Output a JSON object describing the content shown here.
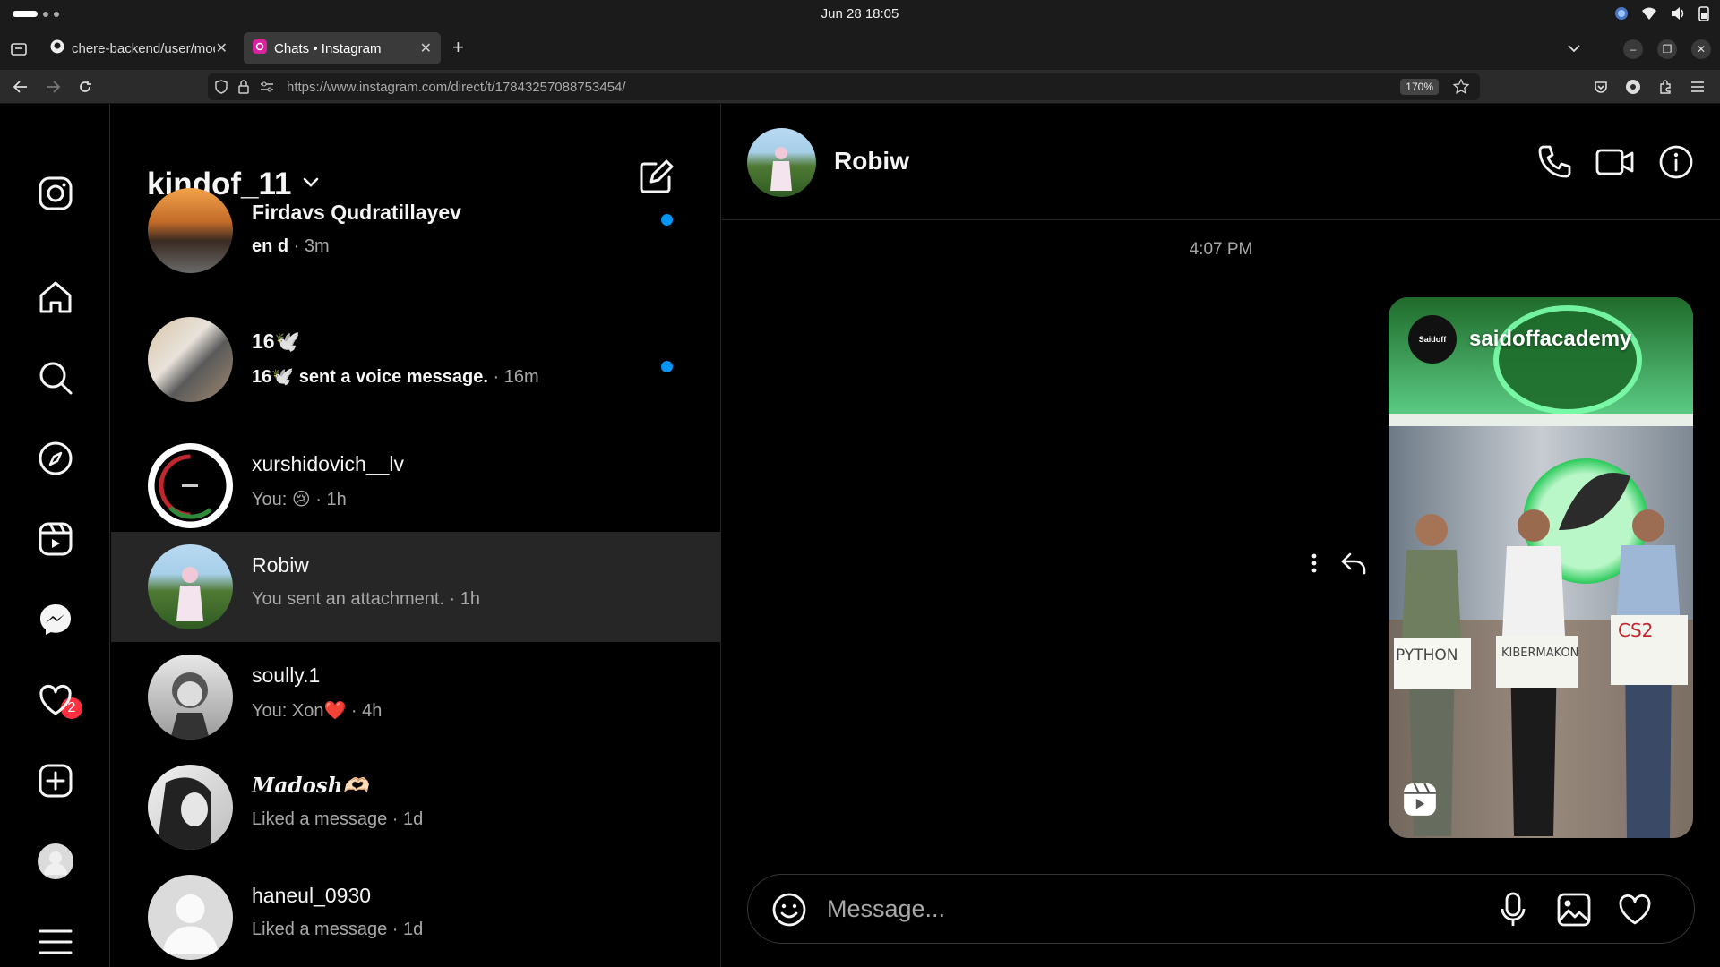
{
  "os": {
    "clock": "Jun 28  18:05"
  },
  "browser": {
    "tabs": [
      {
        "label": "chere-backend/user/mod",
        "active": false
      },
      {
        "label": "Chats • Instagram",
        "active": true
      }
    ],
    "url": "https://www.instagram.com/direct/t/17843257088753454/",
    "zoom": "170%"
  },
  "sidebar": {
    "notification_badge": "2"
  },
  "chat_list": {
    "username": "kindof_11",
    "chats": [
      {
        "name": "Firdavs Qudratillayev",
        "preview": "en d",
        "time": "3m",
        "unread": true
      },
      {
        "name": "16🕊️",
        "preview": "16🕊️ sent a voice message.",
        "time": "16m",
        "unread": true
      },
      {
        "name": "xurshidovich__lv",
        "preview": "You: 😢",
        "time": "1h",
        "unread": false
      },
      {
        "name": "Robiw",
        "preview": "You sent an attachment.",
        "time": "1h",
        "unread": false
      },
      {
        "name": "soully.1",
        "preview": "You: Xon❤️",
        "time": "4h",
        "unread": false
      },
      {
        "name": "𝑴𝒂𝒅𝒐𝒔𝒉🫶🏻",
        "preview": "Liked a message",
        "time": "1d",
        "unread": false
      },
      {
        "name": "haneul_0930",
        "preview": "Liked a message",
        "time": "1d",
        "unread": false
      }
    ]
  },
  "conversation": {
    "contact_name": "Robiw",
    "timestamp": "4:07 PM",
    "shared_reel": {
      "author": "saidoffacademy",
      "author_logo_text": "Saidoff",
      "sign_texts": [
        "PYTHON",
        "KIBERMAKON",
        "CS2"
      ]
    },
    "composer_placeholder": "Message..."
  },
  "colors": {
    "accent_blue": "#0095f6",
    "badge_red": "#ff3040",
    "selected_row": "#262626"
  }
}
